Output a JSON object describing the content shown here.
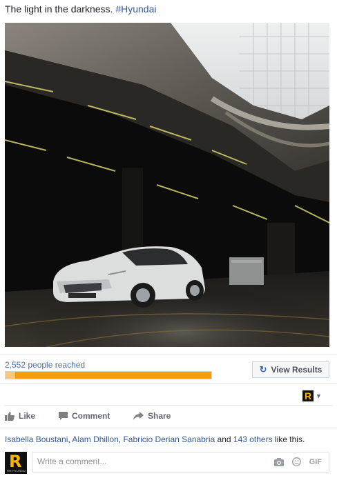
{
  "post": {
    "text": "The light in the darkness.",
    "hashtag": "#Hyundai"
  },
  "insights": {
    "reach_text": "2,552 people reached",
    "progress": 1.0,
    "view_results_label": "View Results"
  },
  "actions": {
    "like": "Like",
    "comment": "Comment",
    "share": "Share"
  },
  "likes": {
    "names": [
      "Isabella Boustani",
      "Alam Dhillon",
      "Fabricio Derian Sanabria"
    ],
    "others_text": "143 others",
    "suffix": "like this."
  },
  "comment": {
    "placeholder": "Write a comment...",
    "gif_label": "GIF"
  },
  "page_logo": {
    "letter": "R",
    "caption": "RM HYUNDAI"
  },
  "colors": {
    "link": "#365899",
    "progress": "#f59e0b",
    "logo_yellow": "#f7b500"
  }
}
